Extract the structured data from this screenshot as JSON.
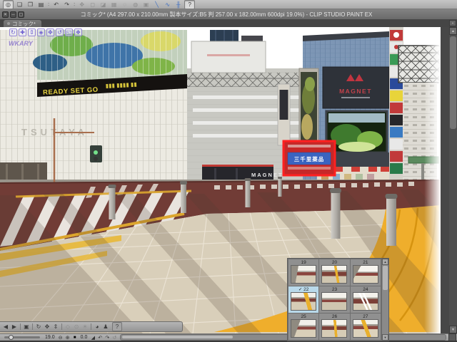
{
  "window": {
    "title": "コミック* (A4 297.00 x 210.00mm 製本サイズ:B5 判 257.00 x 182.00mm 600dpi 19.0%) - CLIP STUDIO PAINT EX",
    "controls": {
      "close": "✕",
      "minimize": "─",
      "maximize": "▢"
    }
  },
  "tab": {
    "label": "コミック*"
  },
  "command_bar": {
    "icons": [
      {
        "name": "clip-studio-icon",
        "glyph": "◎",
        "state": "pressed"
      },
      {
        "name": "new-file-icon",
        "glyph": "❏"
      },
      {
        "name": "open-file-icon",
        "glyph": "❐"
      },
      {
        "name": "save-icon",
        "glyph": "▤"
      },
      {
        "name": "undo-icon",
        "glyph": "↶"
      },
      {
        "name": "redo-icon",
        "glyph": "↷"
      },
      {
        "name": "scale-rotate-icon",
        "glyph": "✥",
        "disabled": true
      },
      {
        "name": "free-transform-icon",
        "glyph": "◻",
        "disabled": true
      },
      {
        "name": "eraser-icon",
        "glyph": "◪",
        "disabled": true
      },
      {
        "name": "crop-icon",
        "glyph": "▦",
        "disabled": true
      },
      {
        "name": "deselect-icon",
        "glyph": "◌",
        "disabled": true
      },
      {
        "name": "invert-selection-icon",
        "glyph": "◍",
        "disabled": true
      },
      {
        "name": "selection-border-icon",
        "glyph": "▣",
        "disabled": true
      },
      {
        "name": "snap-ruler-icon",
        "glyph": "╲",
        "color": "blue"
      },
      {
        "name": "snap-special-ruler-icon",
        "glyph": "∿",
        "color": "blue"
      },
      {
        "name": "snap-grid-icon",
        "glyph": "╫",
        "color": "blue"
      },
      {
        "name": "help-icon",
        "glyph": "?",
        "state": "pressed"
      }
    ],
    "divider": "∶"
  },
  "gizmo": {
    "icons": [
      {
        "name": "camera-orbit-icon",
        "glyph": "↻"
      },
      {
        "name": "camera-pan-icon",
        "glyph": "✚"
      },
      {
        "name": "camera-dolly-icon",
        "glyph": "⇕"
      },
      {
        "name": "plane-move-icon",
        "glyph": "◈"
      },
      {
        "name": "object-pan-icon",
        "glyph": "✥"
      },
      {
        "name": "object-rotate-icon",
        "glyph": "↺"
      },
      {
        "name": "object-scale-icon",
        "glyph": "◱"
      },
      {
        "name": "root-move-icon",
        "glyph": "❖"
      }
    ]
  },
  "scene": {
    "graffiti": "WKARY",
    "ticker": "READY SET GO",
    "ticker_blocks": "▮▮▮ ▮▮▮▮ ▮▮",
    "tsutaya": "TSUTAYA",
    "magnet_store": "MAGNET",
    "magnet_sign": "MAGNET",
    "billboard_text": "三千里薬品"
  },
  "launcher": {
    "icons": [
      {
        "name": "prev-angle-icon",
        "glyph": "◀"
      },
      {
        "name": "next-angle-icon",
        "glyph": "▶"
      },
      {
        "name": "object-list-icon",
        "glyph": "▣"
      },
      {
        "name": "camera-orbit-icon",
        "glyph": "↻"
      },
      {
        "name": "camera-pan-icon",
        "glyph": "✥"
      },
      {
        "name": "camera-zoom-icon",
        "glyph": "⇕"
      },
      {
        "name": "move-object-icon",
        "glyph": "◇",
        "disabled": true
      },
      {
        "name": "rotate-object-icon",
        "glyph": "⊙",
        "disabled": true
      },
      {
        "name": "light-source-icon",
        "glyph": "☀",
        "disabled": true
      },
      {
        "name": "material-sphere-icon",
        "glyph": "◕"
      },
      {
        "name": "pose-icon",
        "glyph": "♟"
      },
      {
        "name": "help-icon",
        "glyph": "?"
      }
    ]
  },
  "statusbar": {
    "zoom": "19.0",
    "angle": "0.0",
    "icons": {
      "zoom_out": "⊖",
      "zoom_in": "⊕",
      "fit": "■",
      "slope": "◢",
      "rotate_left": "↶",
      "rotate_right": "↷",
      "reset": "↺"
    }
  },
  "thumbnail_panel": {
    "items": [
      {
        "label": "19"
      },
      {
        "label": "20"
      },
      {
        "label": "21"
      },
      {
        "label": "✓ 22",
        "selected": true
      },
      {
        "label": "23"
      },
      {
        "label": "24"
      },
      {
        "label": "25"
      },
      {
        "label": "26"
      },
      {
        "label": "27"
      }
    ],
    "scroll_up": "▲",
    "scroll_down": "▼"
  },
  "colors": {
    "selection_red": "#ff2020",
    "billboard_red": "#c62828",
    "billboard_blue": "#3a64c0",
    "road": "#713c36",
    "pavement": "#d9cfba",
    "accent_yellow": "#efae2c",
    "pasteboard": "#474747"
  }
}
